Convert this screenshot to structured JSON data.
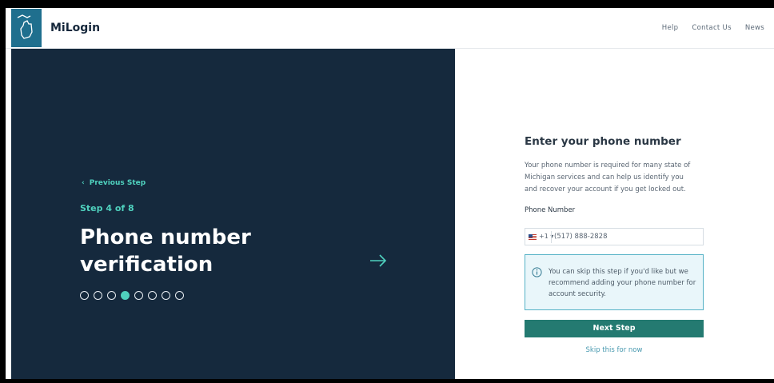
{
  "header": {
    "brand": "MiLogin",
    "nav": [
      "Help",
      "Contact Us",
      "News"
    ]
  },
  "left": {
    "previous_label": "Previous Step",
    "step_label": "Step 4 of 8",
    "title_line1": "Phone number",
    "title_line2": "verification",
    "progress": {
      "total": 8,
      "current": 4
    }
  },
  "form": {
    "heading": "Enter your phone number",
    "description": "Your phone number is required for many state of Michigan services and can help us identify you and recover your account if you get locked out.",
    "phone_label": "Phone Number",
    "country_code": "+1 ▾",
    "phone_placeholder": "(517) 888-2828",
    "info_text": "You can skip this step if you'd like but we recommend adding your phone number for account security.",
    "next_button": "Next Step",
    "skip_link": "Skip this for now"
  },
  "colors": {
    "accent": "#4fd1be",
    "panel": "#15293d",
    "button": "#247a71",
    "logo": "#1f6f8e"
  }
}
